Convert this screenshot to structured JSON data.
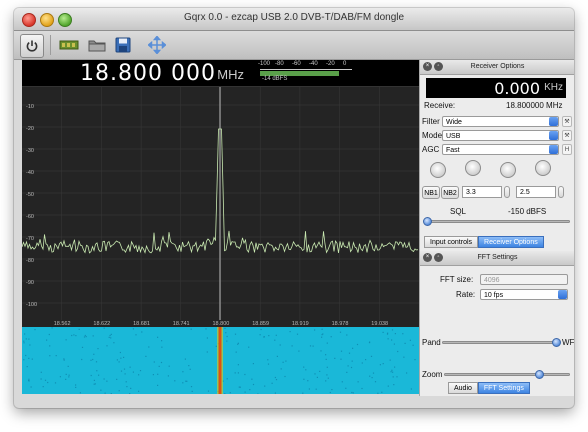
{
  "window": {
    "title": "Gqrx 0.0 - ezcap USB 2.0 DVB-T/DAB/FM dongle"
  },
  "toolbar": {
    "items": [
      {
        "name": "power",
        "icon": "power-icon"
      },
      {
        "name": "device",
        "icon": "device-icon"
      },
      {
        "name": "open",
        "icon": "folder-icon"
      },
      {
        "name": "save",
        "icon": "save-icon"
      },
      {
        "name": "fullscreen",
        "icon": "fullscreen-arrows-icon"
      }
    ]
  },
  "frequency": {
    "value": "18.800 000",
    "unit": "MHz"
  },
  "meter": {
    "scale": [
      "-100",
      "-80",
      "-60",
      "-40",
      "-20",
      "0"
    ],
    "reading": "-14 dBFS",
    "level_dbfs": -14,
    "range_dbfs": [
      -100,
      0
    ]
  },
  "spectrum": {
    "y_labels": [
      "-10",
      "-20",
      "-30",
      "-40",
      "-50",
      "-60",
      "-70",
      "-80",
      "-90",
      "-100"
    ],
    "x_labels": [
      "18.562",
      "18.622",
      "18.681",
      "18.741",
      "18.800",
      "18.859",
      "18.919",
      "18.978",
      "19.038"
    ],
    "colors": {
      "background": "#242424",
      "trace": "#c8e8b0",
      "marker": "#8a8a8a",
      "grid": "#3a3a3a"
    }
  },
  "waterfall": {
    "colors": {
      "base": "#1ab8d8",
      "signal": "#e05010",
      "signal_edge": "#f0d000"
    }
  },
  "receiver": {
    "title": "Receiver Options",
    "display": {
      "value": "0.000",
      "unit": "KHz"
    },
    "receive_label": "Receive:",
    "receive_value": "18.800000 MHz",
    "filter_label": "Filter",
    "filter_value": "Wide",
    "mode_label": "Mode",
    "mode_value": "USB",
    "agc_label": "AGC",
    "agc_value": "Fast",
    "agc_button": "H",
    "nb1": "NB1",
    "nb2": "NB2",
    "nb1_value": "3.3",
    "nb2_value": "2.5",
    "sql_label": "SQL",
    "sql_value": "-150 dBFS"
  },
  "dock_tabs_top": [
    "Input controls",
    "Receiver Options"
  ],
  "fft": {
    "title": "FFT Settings",
    "size_label": "FFT size:",
    "size_value": "4096",
    "rate_label": "Rate:",
    "rate_value": "10 fps",
    "pand_label": "Pand",
    "pand_suffix": "WF",
    "zoom_label": "Zoom"
  },
  "dock_tabs_bottom": [
    "Audio",
    "FFT Settings"
  ],
  "accent": "#3d84e2"
}
